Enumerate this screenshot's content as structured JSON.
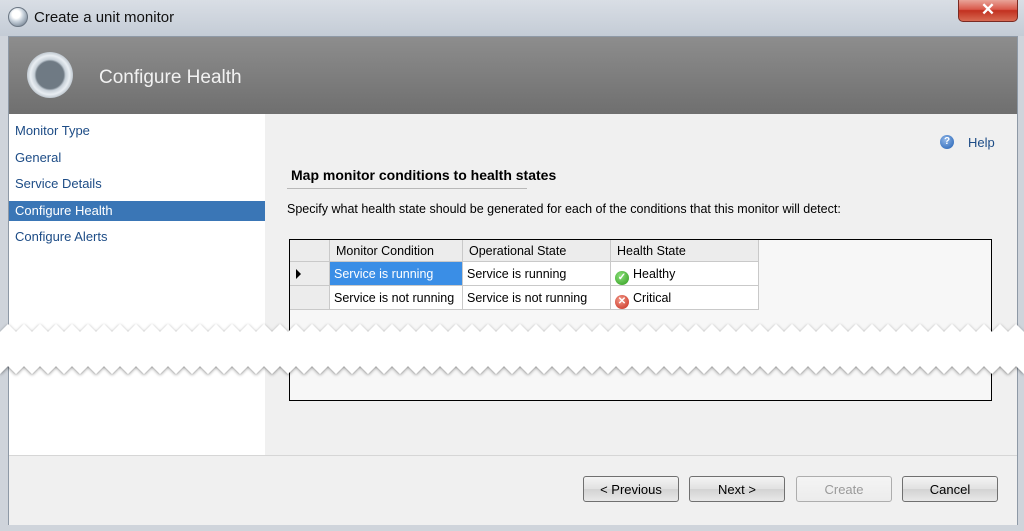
{
  "window": {
    "title": "Create a unit monitor",
    "close_label": "✕"
  },
  "header": {
    "title": "Configure Health"
  },
  "nav": {
    "items": [
      {
        "label": "Monitor Type"
      },
      {
        "label": "General"
      },
      {
        "label": "Service Details"
      },
      {
        "label": "Configure Health",
        "selected": true
      },
      {
        "label": "Configure Alerts"
      }
    ]
  },
  "help": {
    "label": "Help",
    "icon": "help-icon"
  },
  "section": {
    "title": "Map monitor conditions to health states",
    "description": "Specify what health state should be generated for each of the conditions that this monitor will detect:"
  },
  "grid": {
    "columns": [
      "Monitor Condition",
      "Operational State",
      "Health State"
    ],
    "rows": [
      {
        "condition": "Service is running",
        "operational": "Service is running",
        "health": "Healthy",
        "icon": "healthy-check-icon"
      },
      {
        "condition": "Service is not running",
        "operational": "Service is not running",
        "health": "Critical",
        "icon": "critical-x-icon"
      }
    ]
  },
  "buttons": {
    "previous": "< Previous",
    "next": "Next >",
    "create": "Create",
    "cancel": "Cancel"
  },
  "colors": {
    "selection": "#3a76b6",
    "cell_selection": "#3a8ee6",
    "header_bar": "#7c7c7c",
    "link": "#1d4c86"
  }
}
